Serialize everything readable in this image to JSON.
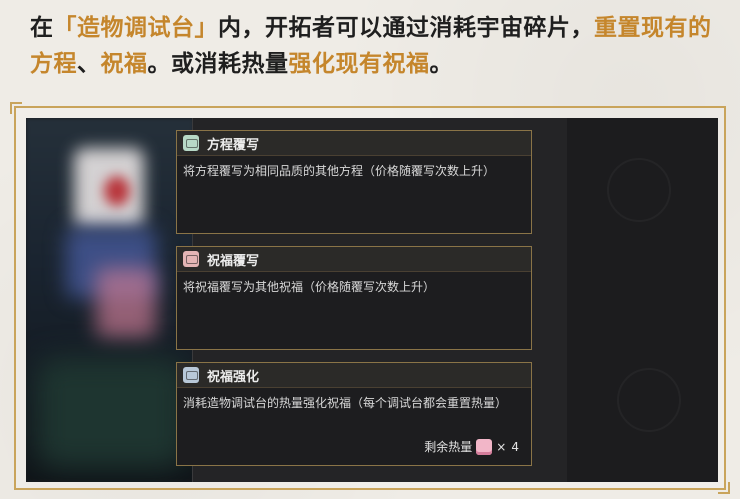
{
  "headline": {
    "p1": "在",
    "h1": "「造物调试台」",
    "p2": "内，开拓者可以通过消耗宇宙碎片，",
    "h2": "重置现有的方程",
    "p3": "、",
    "h3": "祝福",
    "p4": "。或消耗热量",
    "h4": "强化现有祝福",
    "p5": "。"
  },
  "cards": [
    {
      "title": "方程覆写",
      "desc": "将方程覆写为相同品质的其他方程（价格随覆写次数上升）",
      "icon": "equation-icon"
    },
    {
      "title": "祝福覆写",
      "desc": "将祝福覆写为其他祝福（价格随覆写次数上升）",
      "icon": "blessing-icon"
    },
    {
      "title": "祝福强化",
      "desc": "消耗造物调试台的热量强化祝福（每个调试台都会重置热量）",
      "icon": "enhance-icon"
    }
  ],
  "heat": {
    "label": "剩余热量",
    "mult": "×",
    "count": "4"
  },
  "colors": {
    "accent": "#c5862c",
    "border": "#8a7447",
    "frame": "#c9a45b"
  }
}
